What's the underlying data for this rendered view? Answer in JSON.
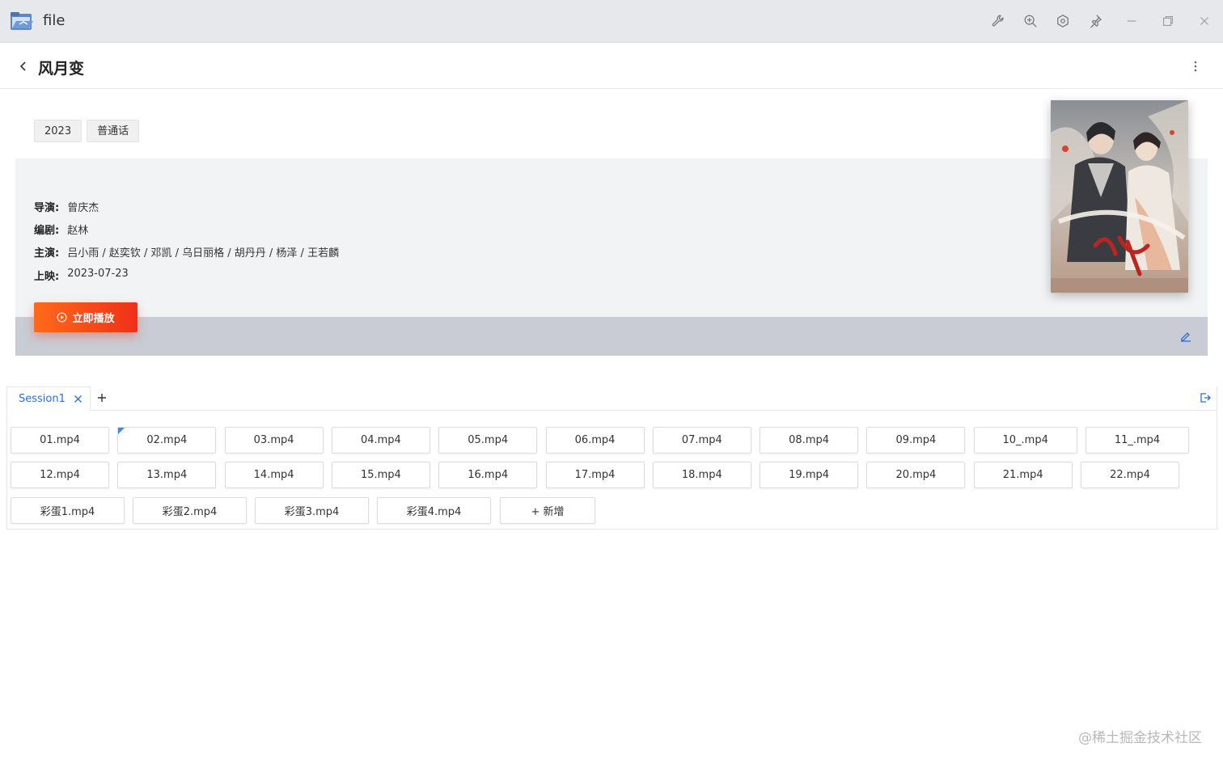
{
  "window": {
    "title": "file"
  },
  "header": {
    "title": "风月变"
  },
  "tags": [
    "2023",
    "普通话"
  ],
  "meta": [
    {
      "label": "导演:",
      "value": "曾庆杰"
    },
    {
      "label": "编剧:",
      "value": "赵林"
    },
    {
      "label": "主演:",
      "value": "吕小雨 / 赵奕钦 / 邓凯 / 乌日丽格 / 胡丹丹 / 杨泽 / 王若麟"
    },
    {
      "label": "上映:",
      "value": "2023-07-23"
    }
  ],
  "play_button": {
    "label": "立即播放"
  },
  "tabs": [
    {
      "label": "Session1"
    }
  ],
  "episodes_row1": [
    "01.mp4",
    "02.mp4",
    "03.mp4",
    "04.mp4",
    "05.mp4",
    "06.mp4",
    "07.mp4",
    "08.mp4",
    "09.mp4",
    "10_.mp4",
    "11_.mp4"
  ],
  "episodes_row2": [
    "12.mp4",
    "13.mp4",
    "14.mp4",
    "15.mp4",
    "16.mp4",
    "17.mp4",
    "18.mp4",
    "19.mp4",
    "20.mp4",
    "21.mp4",
    "22.mp4"
  ],
  "episodes_row3": [
    "彩蛋1.mp4",
    "彩蛋2.mp4",
    "彩蛋3.mp4",
    "彩蛋4.mp4"
  ],
  "add_episode_label": "+ 新增",
  "watermark": "@稀土掘金技术社区",
  "colors": {
    "accent": "#2b6fd6",
    "play_start": "#ff6a1a",
    "play_end": "#f0301a"
  }
}
